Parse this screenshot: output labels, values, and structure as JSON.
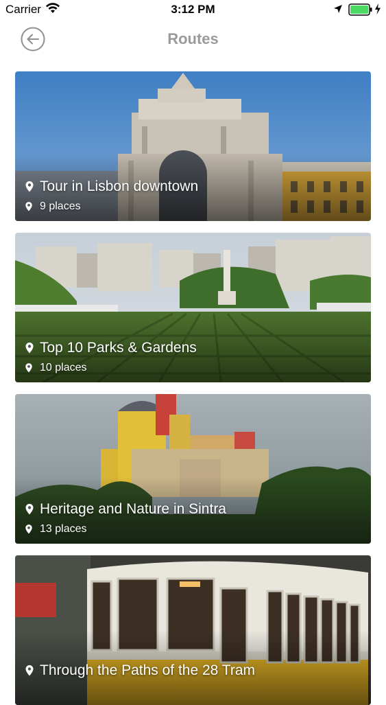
{
  "status_bar": {
    "carrier": "Carrier",
    "time": "3:12 PM"
  },
  "header": {
    "title": "Routes"
  },
  "routes": [
    {
      "title": "Tour in Lisbon downtown",
      "places": "9 places"
    },
    {
      "title": "Top 10 Parks & Gardens",
      "places": "10 places"
    },
    {
      "title": "Heritage and Nature in Sintra",
      "places": "13 places"
    },
    {
      "title": "Through the Paths of the 28 Tram",
      "places": ""
    }
  ],
  "icons": {
    "back": "back-arrow-circle-icon",
    "place": "location-pin-icon"
  },
  "colors": {
    "title_gray": "#9a9a9a",
    "battery_green": "#4cd964"
  }
}
